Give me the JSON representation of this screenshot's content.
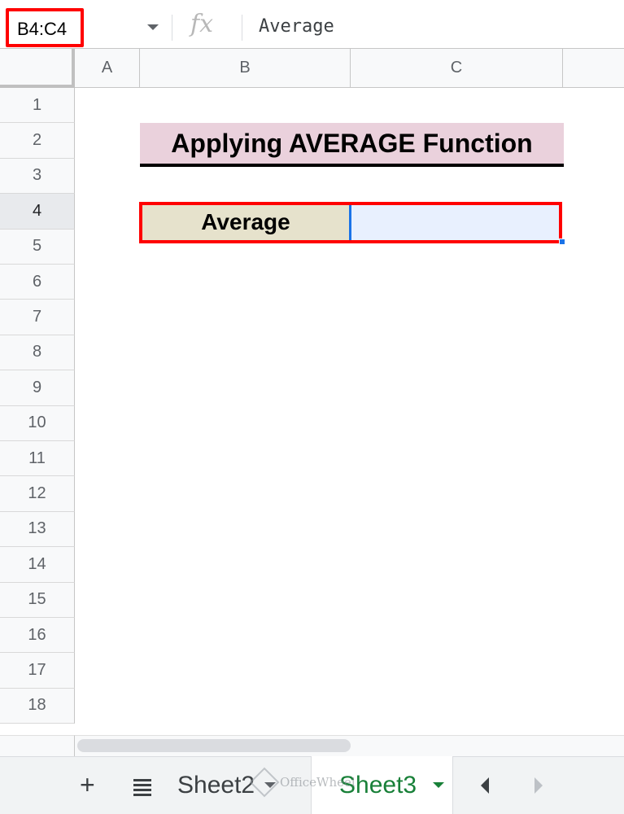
{
  "formula_bar": {
    "name_box": "B4:C4",
    "fx_symbol": "fx",
    "formula": "Average"
  },
  "columns": [
    "A",
    "B",
    "C"
  ],
  "rows": [
    "1",
    "2",
    "3",
    "4",
    "5",
    "6",
    "7",
    "8",
    "9",
    "10",
    "11",
    "12",
    "13",
    "14",
    "15",
    "16",
    "17",
    "18"
  ],
  "cells": {
    "title": "Applying AVERAGE Function",
    "average_label": "Average",
    "average_value": ""
  },
  "colors": {
    "title_fill": "#ead1dc",
    "label_fill": "#e6e2cc",
    "selection_fill": "#e8f0fe",
    "highlight_box": "#ff0000",
    "active_tab": "#188038"
  },
  "tabs": {
    "add_symbol": "+",
    "sheets": [
      "Sheet2",
      "Sheet3"
    ],
    "active": "Sheet3"
  },
  "watermark": "OfficeWheel"
}
